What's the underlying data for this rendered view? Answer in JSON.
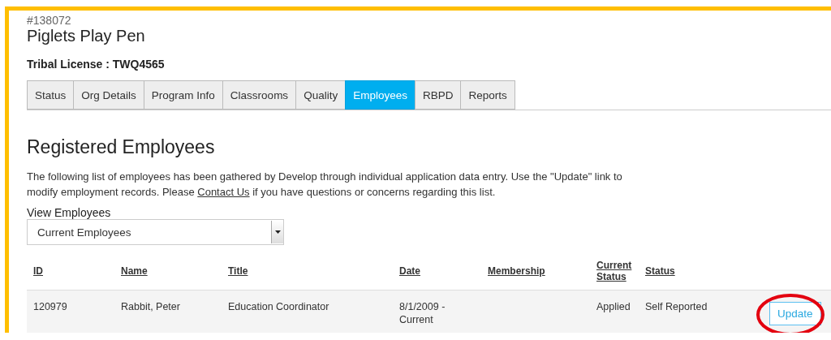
{
  "org": {
    "number": "#138072",
    "name": "Piglets Play Pen",
    "license": "Tribal License : TWQ4565"
  },
  "tabs": [
    {
      "label": "Status",
      "selected": false
    },
    {
      "label": "Org Details",
      "selected": false
    },
    {
      "label": "Program Info",
      "selected": false
    },
    {
      "label": "Classrooms",
      "selected": false
    },
    {
      "label": "Quality",
      "selected": false
    },
    {
      "label": "Employees",
      "selected": true
    },
    {
      "label": "RBPD",
      "selected": false
    },
    {
      "label": "Reports",
      "selected": false
    }
  ],
  "heading": "Registered Employees",
  "intro": {
    "before": "The following list of employees has been gathered by Develop through individual application data entry. Use the \"Update\" link to modify employment records. Please ",
    "link": "Contact Us",
    "after": " if you have questions or concerns regarding this list."
  },
  "filter": {
    "label": "View Employees",
    "value": "Current Employees"
  },
  "table": {
    "columns": [
      "ID",
      "Name",
      "Title",
      "Date",
      "Membership",
      "Current Status",
      "Status"
    ],
    "rows": [
      {
        "cells": [
          "120979",
          "Rabbit, Peter",
          "Education Coordinator",
          "8/1/2009 - Current",
          "",
          "Applied",
          "Self Reported"
        ],
        "action": "Update",
        "circled": true
      }
    ]
  }
}
